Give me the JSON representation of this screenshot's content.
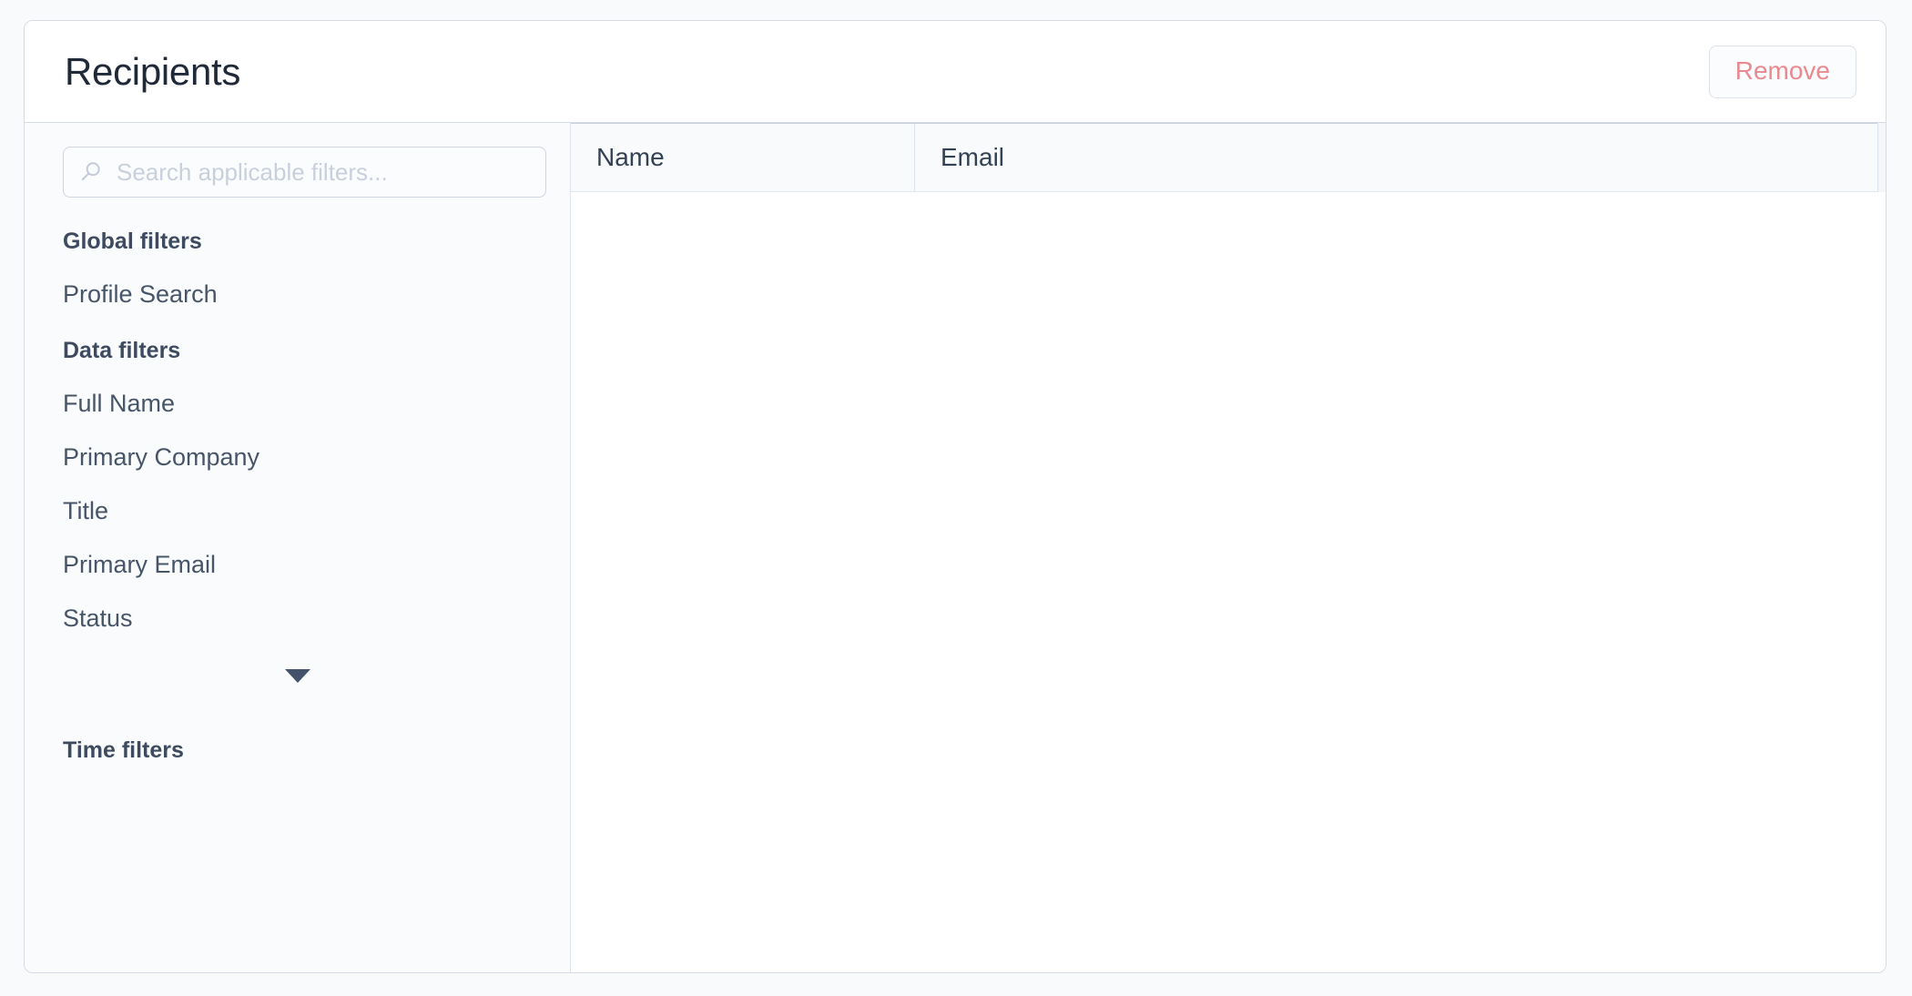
{
  "header": {
    "title": "Recipients",
    "remove_label": "Remove"
  },
  "sidebar": {
    "search": {
      "placeholder": "Search applicable filters...",
      "value": "",
      "icon": "search-icon"
    },
    "groups": [
      {
        "heading": "Global filters",
        "items": [
          "Profile Search"
        ]
      },
      {
        "heading": "Data filters",
        "items": [
          "Full Name",
          "Primary Company",
          "Title",
          "Primary Email",
          "Status"
        ],
        "expand_icon": "chevron-down-icon"
      },
      {
        "heading": "Time filters",
        "items": []
      }
    ]
  },
  "table": {
    "columns": [
      {
        "label": "Name"
      },
      {
        "label": "Email"
      }
    ],
    "rows": []
  },
  "colors": {
    "page_background": "#f8fafc",
    "card_background": "#ffffff",
    "card_border": "#d5dae3",
    "sidebar_background": "#f9fbfd",
    "title_text": "#1f2937",
    "heading_text": "#3d4a60",
    "item_text": "#475569",
    "remove_text": "#ea8a8f",
    "placeholder_text": "#c8d0dd",
    "table_header_background": "#f8fafc",
    "scrollbar_thumb": "#bfc0c1"
  }
}
